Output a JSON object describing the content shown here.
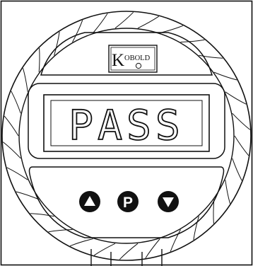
{
  "logo": {
    "letter": "K",
    "brand": "OBOLD"
  },
  "display": {
    "text": "PASS"
  },
  "buttons": [
    {
      "id": "up",
      "icon": "triangle-up-icon"
    },
    {
      "id": "program",
      "label": "P",
      "icon": "p-icon"
    },
    {
      "id": "down",
      "icon": "triangle-down-icon"
    }
  ],
  "colors": {
    "outline": "#111111",
    "button_fill": "#111111",
    "glyph": "#ffffff",
    "background": "#ffffff"
  }
}
